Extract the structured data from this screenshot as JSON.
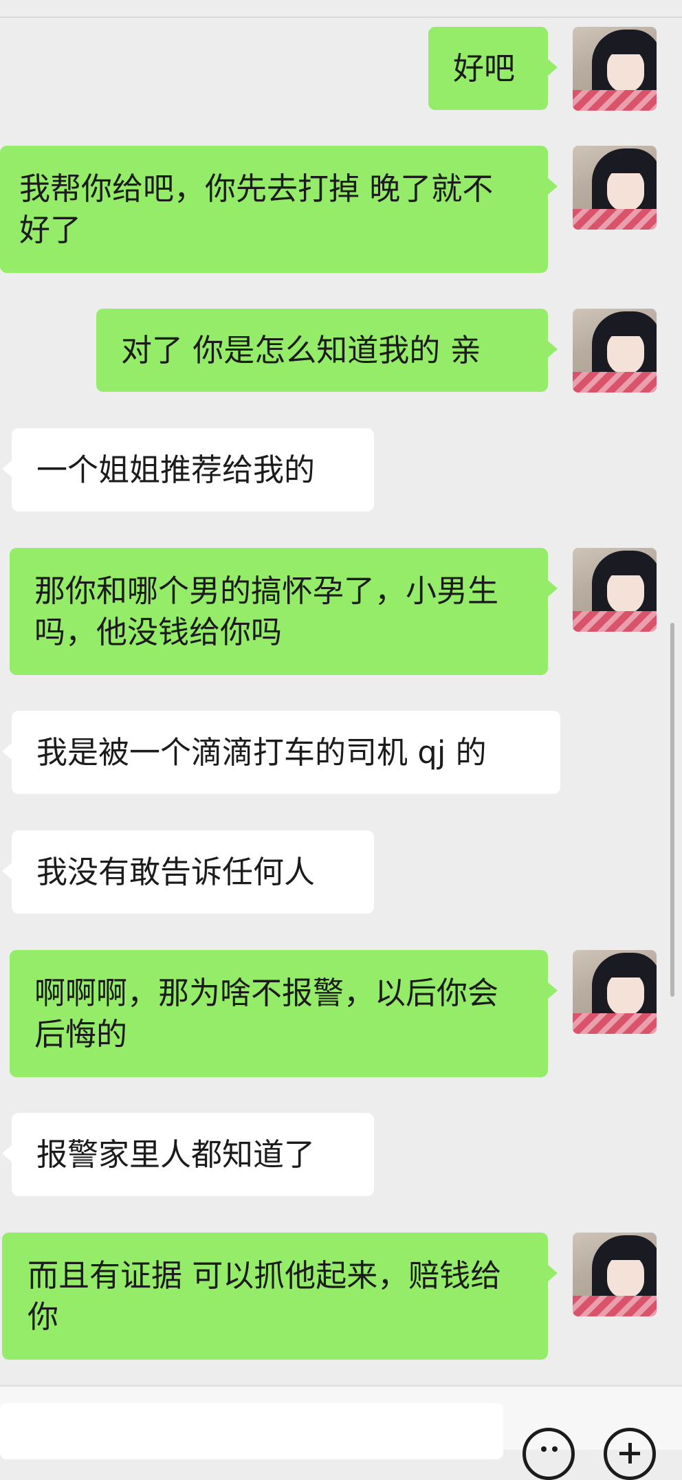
{
  "messages": [
    {
      "sender": "me",
      "text": "好吧"
    },
    {
      "sender": "me",
      "text": "我帮你给吧，你先去打掉  晚了就不好了"
    },
    {
      "sender": "me",
      "text": "对了 你是怎么知道我的 亲"
    },
    {
      "sender": "other",
      "text": "一个姐姐推荐给我的"
    },
    {
      "sender": "me",
      "text": "那你和哪个男的搞怀孕了，小男生吗，他没钱给你吗"
    },
    {
      "sender": "other",
      "text": "我是被一个滴滴打车的司机 qj 的"
    },
    {
      "sender": "other",
      "text": "我没有敢告诉任何人"
    },
    {
      "sender": "me",
      "text": "啊啊啊，那为啥不报警，以后你会后悔的"
    },
    {
      "sender": "other",
      "text": "报警家里人都知道了"
    },
    {
      "sender": "me",
      "text": "而且有证据 可以抓他起来，赔钱给你"
    }
  ],
  "input_bar": {
    "placeholder": "",
    "emoji_icon": "emoji-icon",
    "add_icon": "plus-icon"
  },
  "colors": {
    "background": "#ededed",
    "my_bubble": "#95ec69",
    "other_bubble": "#ffffff"
  }
}
